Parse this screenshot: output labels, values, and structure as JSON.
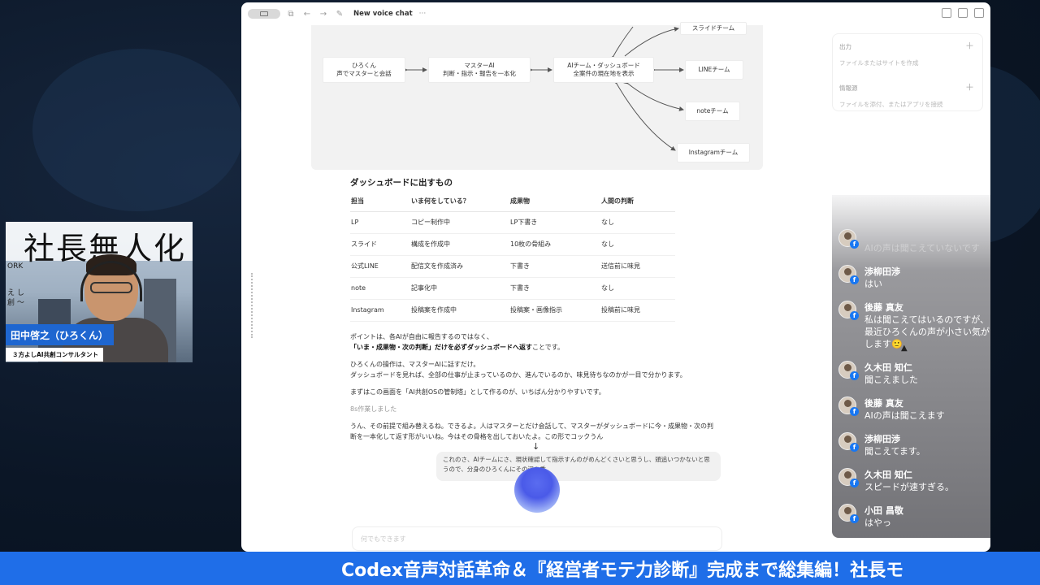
{
  "window": {
    "title": "New voice chat",
    "more": "···"
  },
  "diagram": {
    "nodes": {
      "hirokun": [
        "ひろくん",
        "声でマスターと会話"
      ],
      "master": [
        "マスターAI",
        "判断・指示・報告を一本化"
      ],
      "dashboard": [
        "AIチーム・ダッシュボード",
        "全案件の現在地を表示"
      ],
      "slide": "スライドチーム",
      "line": "LINEチーム",
      "note": "noteチーム",
      "instagram": "Instagramチーム"
    }
  },
  "content": {
    "heading": "ダッシュボードに出すもの",
    "table": {
      "headers": [
        "担当",
        "いま何をしている？",
        "成果物",
        "人間の判断"
      ],
      "rows": [
        [
          "LP",
          "コピー制作中",
          "LP下書き",
          "なし"
        ],
        [
          "スライド",
          "構成を作成中",
          "10枚の骨組み",
          "なし"
        ],
        [
          "公式LINE",
          "配信文を作成済み",
          "下書き",
          "送信前に味見"
        ],
        [
          "note",
          "記事化中",
          "下書き",
          "なし"
        ],
        [
          "Instagram",
          "投稿案を作成中",
          "投稿案・画像指示",
          "投稿前に味見"
        ]
      ]
    },
    "p1_line1": "ポイントは、各AIが自由に報告するのではなく、",
    "p1_bold": "「いま・成果物・次の判断」だけを必ずダッシュボードへ返す",
    "p1_tail": "ことです。",
    "p2_line1": "ひろくんの操作は、マスターAIに話すだけ。",
    "p2_line2": "ダッシュボードを見れば、全部の仕事が止まっているのか、進んでいるのか、味見待ちなのかが一目で分かります。",
    "p3": "まずはこの画面を「AI共創OSの管制塔」として作るのが、いちばん分かりやすいです。",
    "worked": "8s作業しました",
    "p4": "うん、その前提で組み替えるね。できるよ。人はマスターとだけ会話して、マスターがダッシュボードに今・成果物・次の判断を一本化して返す形がいいね。今はその骨格を出しておいたよ。この形でコックうん",
    "down_arrow": "↓",
    "user_msg": "これのさ、AIチームにさ、現状確認して指示すんのがめんどくさいと思うし、頭追いつかないと思うので、分身のひろくんにその辺を委",
    "composer_placeholder": "何でもできます"
  },
  "side_panel": {
    "output_label": "出力",
    "output_sub": "ファイルまたはサイトを作成",
    "source_label": "情報源",
    "source_sub": "ファイルを添付、またはアプリを接続"
  },
  "comments": [
    {
      "name": "",
      "text": "AIの声は聞こえていないです",
      "faded": true
    },
    {
      "name": "渉柳田渉",
      "text": "はい"
    },
    {
      "name": "後藤 真友",
      "text": "私は聞こえてはいるのですが、最近ひろくんの声が小さい気がします🙂"
    },
    {
      "name": "久木田 知仁",
      "text": "聞こえました"
    },
    {
      "name": "後藤 真友",
      "text": "AIの声は聞こえます"
    },
    {
      "name": "渉柳田渉",
      "text": "聞こえてます。"
    },
    {
      "name": "久木田 知仁",
      "text": "スピードが速すぎる。"
    },
    {
      "name": "小田 昌敬",
      "text": "はやっ"
    }
  ],
  "webcam": {
    "banner": "社長無人化",
    "small1": "ORK",
    "small2": "え し\n創 ～",
    "name": "田中啓之（ひろくん）",
    "subtitle": "３方よしAI共創コンサルタント"
  },
  "ticker": "Codex音声対話革命＆『経営者モテ力診断』完成まで総集編！社長モ"
}
